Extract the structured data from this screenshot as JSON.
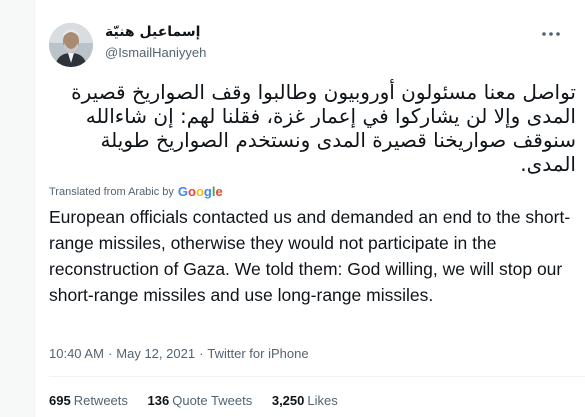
{
  "tweet": {
    "author": {
      "display_name": "إسماعيل هنيّة",
      "handle": "@IsmailHaniyyeh"
    },
    "more_icon": "more-horizontal-icon",
    "text_original": "تواصل معنا مسئولون أوروبيون وطالبوا وقف الصواريخ قصيرة المدى وإلا لن يشاركوا في إعمار غزة، فقلنا لهم: إن شاءالله سنوقف صواريخنا قصيرة المدى ونستخدم الصواريخ طويلة المدى.",
    "translation": {
      "prefix": "Translated from Arabic",
      "by": "by",
      "provider": "Google",
      "text": "European officials contacted us and demanded an end to the short-range missiles, otherwise they would not participate in the reconstruction of Gaza. We told them: God willing, we will stop our short-range missiles and use long-range missiles."
    },
    "time": "10:40 AM",
    "date": "May 12, 2021",
    "separator": "·",
    "source": "Twitter for iPhone",
    "stats": {
      "retweets_count": "695",
      "retweets_label": "Retweets",
      "quote_count": "136",
      "quote_label": "Quote Tweets",
      "likes_count": "3,250",
      "likes_label": "Likes"
    }
  },
  "colors": {
    "text": "#0f1419",
    "secondary": "#536471",
    "border": "#eff3f4",
    "google_blue": "#4285f4",
    "google_red": "#ea4335",
    "google_yellow": "#fbbc05",
    "google_green": "#34a853"
  }
}
